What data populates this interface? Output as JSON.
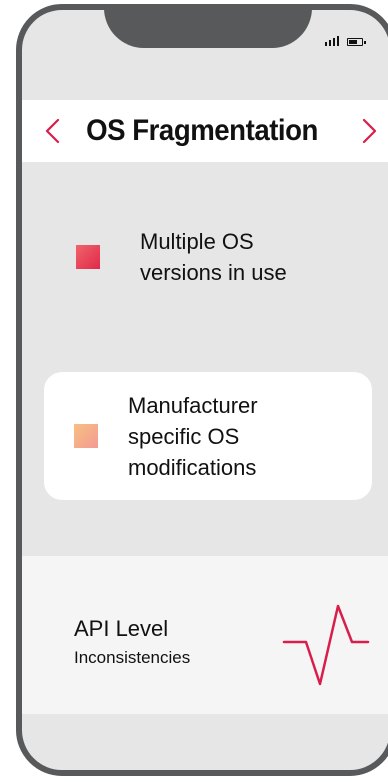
{
  "header": {
    "title": "OS Fragmentation"
  },
  "items": [
    {
      "text": "Multiple OS versions in use",
      "marker": "red-gradient-square"
    },
    {
      "text": "Manufacturer specific OS modifications",
      "marker": "peach-gradient-square"
    }
  ],
  "api": {
    "title": "API Level",
    "subtitle": "Inconsistencies",
    "icon": "heartbeat-pulse-icon"
  },
  "colors": {
    "accent": "#d81e4a",
    "phone_frame": "#58595b",
    "screen_bg": "#e6e6e6",
    "card_bg": "#ffffff",
    "api_bg": "#f5f5f5"
  }
}
